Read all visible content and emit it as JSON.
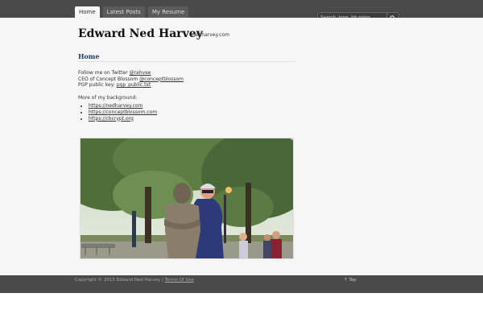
{
  "nav": {
    "tabs": [
      {
        "label": "Home",
        "active": true
      },
      {
        "label": "Latest Posts",
        "active": false
      },
      {
        "label": "My Resume",
        "active": false
      }
    ]
  },
  "search": {
    "placeholder": "Search: type, hit enter",
    "icon": "search-icon"
  },
  "site": {
    "title": "Edward Ned Harvey",
    "description": "nedharvey.com"
  },
  "page": {
    "title": "Home",
    "twitter_prefix": "Follow me on Twitter ",
    "twitter_handle": "@rahvee",
    "ceo_prefix": "CEO of Concept Blossom ",
    "ceo_handle": "@conceptblossom",
    "pgp_prefix": "PGP public key: ",
    "pgp_link": "pgp_public.txt",
    "background_label": "More of my background:",
    "background_links": [
      "https://nedharvey.com",
      "https://conceptblossom.com",
      "https://cbcrypt.org"
    ]
  },
  "footer": {
    "copyright_text": "Copyright © 2015 Edward Ned Harvey | ",
    "terms_link": "Terms Of Use",
    "top_label": "↑ Top"
  },
  "colors": {
    "topbar": "#4a4a4a",
    "page_bg": "#f6f6f6",
    "heading_blue": "#1b3e6e"
  }
}
